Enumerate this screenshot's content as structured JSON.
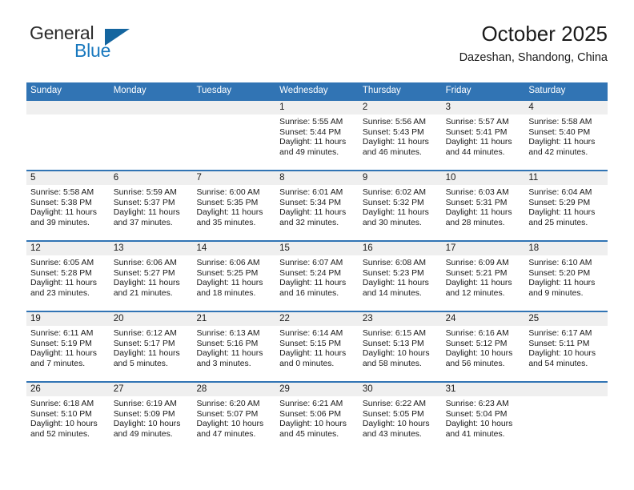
{
  "brand": {
    "name_part1": "General",
    "name_part2": "Blue",
    "triangle_color": "#14659f",
    "blue_color": "#1878be"
  },
  "header": {
    "title": "October 2025",
    "subtitle": "Dazeshan, Shandong, China",
    "accent_color": "#3174b4",
    "daynum_band_color": "#efefef"
  },
  "calendar": {
    "weekday_headers": [
      "Sunday",
      "Monday",
      "Tuesday",
      "Wednesday",
      "Thursday",
      "Friday",
      "Saturday"
    ],
    "weeks": [
      [
        {
          "day": "",
          "sunrise": "",
          "sunset": "",
          "daylight1": "",
          "daylight2": ""
        },
        {
          "day": "",
          "sunrise": "",
          "sunset": "",
          "daylight1": "",
          "daylight2": ""
        },
        {
          "day": "",
          "sunrise": "",
          "sunset": "",
          "daylight1": "",
          "daylight2": ""
        },
        {
          "day": "1",
          "sunrise": "Sunrise: 5:55 AM",
          "sunset": "Sunset: 5:44 PM",
          "daylight1": "Daylight: 11 hours",
          "daylight2": "and 49 minutes."
        },
        {
          "day": "2",
          "sunrise": "Sunrise: 5:56 AM",
          "sunset": "Sunset: 5:43 PM",
          "daylight1": "Daylight: 11 hours",
          "daylight2": "and 46 minutes."
        },
        {
          "day": "3",
          "sunrise": "Sunrise: 5:57 AM",
          "sunset": "Sunset: 5:41 PM",
          "daylight1": "Daylight: 11 hours",
          "daylight2": "and 44 minutes."
        },
        {
          "day": "4",
          "sunrise": "Sunrise: 5:58 AM",
          "sunset": "Sunset: 5:40 PM",
          "daylight1": "Daylight: 11 hours",
          "daylight2": "and 42 minutes."
        }
      ],
      [
        {
          "day": "5",
          "sunrise": "Sunrise: 5:58 AM",
          "sunset": "Sunset: 5:38 PM",
          "daylight1": "Daylight: 11 hours",
          "daylight2": "and 39 minutes."
        },
        {
          "day": "6",
          "sunrise": "Sunrise: 5:59 AM",
          "sunset": "Sunset: 5:37 PM",
          "daylight1": "Daylight: 11 hours",
          "daylight2": "and 37 minutes."
        },
        {
          "day": "7",
          "sunrise": "Sunrise: 6:00 AM",
          "sunset": "Sunset: 5:35 PM",
          "daylight1": "Daylight: 11 hours",
          "daylight2": "and 35 minutes."
        },
        {
          "day": "8",
          "sunrise": "Sunrise: 6:01 AM",
          "sunset": "Sunset: 5:34 PM",
          "daylight1": "Daylight: 11 hours",
          "daylight2": "and 32 minutes."
        },
        {
          "day": "9",
          "sunrise": "Sunrise: 6:02 AM",
          "sunset": "Sunset: 5:32 PM",
          "daylight1": "Daylight: 11 hours",
          "daylight2": "and 30 minutes."
        },
        {
          "day": "10",
          "sunrise": "Sunrise: 6:03 AM",
          "sunset": "Sunset: 5:31 PM",
          "daylight1": "Daylight: 11 hours",
          "daylight2": "and 28 minutes."
        },
        {
          "day": "11",
          "sunrise": "Sunrise: 6:04 AM",
          "sunset": "Sunset: 5:29 PM",
          "daylight1": "Daylight: 11 hours",
          "daylight2": "and 25 minutes."
        }
      ],
      [
        {
          "day": "12",
          "sunrise": "Sunrise: 6:05 AM",
          "sunset": "Sunset: 5:28 PM",
          "daylight1": "Daylight: 11 hours",
          "daylight2": "and 23 minutes."
        },
        {
          "day": "13",
          "sunrise": "Sunrise: 6:06 AM",
          "sunset": "Sunset: 5:27 PM",
          "daylight1": "Daylight: 11 hours",
          "daylight2": "and 21 minutes."
        },
        {
          "day": "14",
          "sunrise": "Sunrise: 6:06 AM",
          "sunset": "Sunset: 5:25 PM",
          "daylight1": "Daylight: 11 hours",
          "daylight2": "and 18 minutes."
        },
        {
          "day": "15",
          "sunrise": "Sunrise: 6:07 AM",
          "sunset": "Sunset: 5:24 PM",
          "daylight1": "Daylight: 11 hours",
          "daylight2": "and 16 minutes."
        },
        {
          "day": "16",
          "sunrise": "Sunrise: 6:08 AM",
          "sunset": "Sunset: 5:23 PM",
          "daylight1": "Daylight: 11 hours",
          "daylight2": "and 14 minutes."
        },
        {
          "day": "17",
          "sunrise": "Sunrise: 6:09 AM",
          "sunset": "Sunset: 5:21 PM",
          "daylight1": "Daylight: 11 hours",
          "daylight2": "and 12 minutes."
        },
        {
          "day": "18",
          "sunrise": "Sunrise: 6:10 AM",
          "sunset": "Sunset: 5:20 PM",
          "daylight1": "Daylight: 11 hours",
          "daylight2": "and 9 minutes."
        }
      ],
      [
        {
          "day": "19",
          "sunrise": "Sunrise: 6:11 AM",
          "sunset": "Sunset: 5:19 PM",
          "daylight1": "Daylight: 11 hours",
          "daylight2": "and 7 minutes."
        },
        {
          "day": "20",
          "sunrise": "Sunrise: 6:12 AM",
          "sunset": "Sunset: 5:17 PM",
          "daylight1": "Daylight: 11 hours",
          "daylight2": "and 5 minutes."
        },
        {
          "day": "21",
          "sunrise": "Sunrise: 6:13 AM",
          "sunset": "Sunset: 5:16 PM",
          "daylight1": "Daylight: 11 hours",
          "daylight2": "and 3 minutes."
        },
        {
          "day": "22",
          "sunrise": "Sunrise: 6:14 AM",
          "sunset": "Sunset: 5:15 PM",
          "daylight1": "Daylight: 11 hours",
          "daylight2": "and 0 minutes."
        },
        {
          "day": "23",
          "sunrise": "Sunrise: 6:15 AM",
          "sunset": "Sunset: 5:13 PM",
          "daylight1": "Daylight: 10 hours",
          "daylight2": "and 58 minutes."
        },
        {
          "day": "24",
          "sunrise": "Sunrise: 6:16 AM",
          "sunset": "Sunset: 5:12 PM",
          "daylight1": "Daylight: 10 hours",
          "daylight2": "and 56 minutes."
        },
        {
          "day": "25",
          "sunrise": "Sunrise: 6:17 AM",
          "sunset": "Sunset: 5:11 PM",
          "daylight1": "Daylight: 10 hours",
          "daylight2": "and 54 minutes."
        }
      ],
      [
        {
          "day": "26",
          "sunrise": "Sunrise: 6:18 AM",
          "sunset": "Sunset: 5:10 PM",
          "daylight1": "Daylight: 10 hours",
          "daylight2": "and 52 minutes."
        },
        {
          "day": "27",
          "sunrise": "Sunrise: 6:19 AM",
          "sunset": "Sunset: 5:09 PM",
          "daylight1": "Daylight: 10 hours",
          "daylight2": "and 49 minutes."
        },
        {
          "day": "28",
          "sunrise": "Sunrise: 6:20 AM",
          "sunset": "Sunset: 5:07 PM",
          "daylight1": "Daylight: 10 hours",
          "daylight2": "and 47 minutes."
        },
        {
          "day": "29",
          "sunrise": "Sunrise: 6:21 AM",
          "sunset": "Sunset: 5:06 PM",
          "daylight1": "Daylight: 10 hours",
          "daylight2": "and 45 minutes."
        },
        {
          "day": "30",
          "sunrise": "Sunrise: 6:22 AM",
          "sunset": "Sunset: 5:05 PM",
          "daylight1": "Daylight: 10 hours",
          "daylight2": "and 43 minutes."
        },
        {
          "day": "31",
          "sunrise": "Sunrise: 6:23 AM",
          "sunset": "Sunset: 5:04 PM",
          "daylight1": "Daylight: 10 hours",
          "daylight2": "and 41 minutes."
        },
        {
          "day": "",
          "sunrise": "",
          "sunset": "",
          "daylight1": "",
          "daylight2": ""
        }
      ]
    ]
  }
}
